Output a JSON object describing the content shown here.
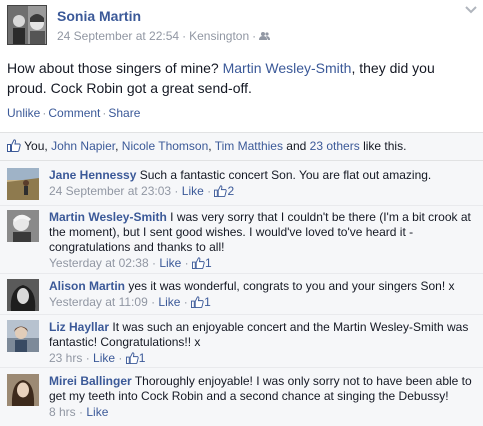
{
  "post": {
    "author": "Sonia Martin",
    "date": "24 September at 22:54",
    "location": "Kensington",
    "text_before": "How about those singers of mine? ",
    "mention": "Martin Wesley-Smith",
    "text_after": ", they did you proud. Cock Robin got a great send-off.",
    "actions": {
      "unlike": "Unlike",
      "comment": "Comment",
      "share": "Share"
    }
  },
  "likes": {
    "you": "You,",
    "names": [
      "John Napier",
      "Nicole Thomson",
      "Tim Matthies"
    ],
    "and": "and",
    "others": "23 others",
    "suffix": "like this."
  },
  "comments": [
    {
      "author": "Jane Hennessy",
      "text": "Such a fantastic concert Son. You are flat out amazing.",
      "time": "24 September at 23:03",
      "like": "Like",
      "count": "2"
    },
    {
      "author": "Martin Wesley-Smith",
      "text": "I was very sorry that I couldn't be there (I'm a bit crook at the moment), but I sent good wishes. I would've loved to've heard it - congratulations and thanks to all!",
      "time": "Yesterday at 02:38",
      "like": "Like",
      "count": "1"
    },
    {
      "author": "Alison Martin",
      "text": "yes it was wonderful, congrats to you and your singers Son! x",
      "time": "Yesterday at 11:09",
      "like": "Like",
      "count": "1"
    },
    {
      "author": "Liz Hayllar",
      "text": "It was such an enjoyable concert and the Martin Wesley-Smith was fantastic! Congratulations!! x",
      "time": "23 hrs",
      "like": "Like",
      "count": "1"
    },
    {
      "author": "Mirei Ballinger",
      "text": "Thoroughly enjoyable! I was only sorry not to have been able to get my teeth into Cock Robin and a second chance at singing the Debussy!",
      "time": "8 hrs",
      "like": "Like",
      "count": ""
    }
  ],
  "colors": {
    "link": "#3b5998",
    "meta": "#9197a3",
    "ufi_bg": "#f6f7f9"
  },
  "icons": {
    "audience": "friends-icon",
    "menu": "chevron-down-icon",
    "like": "thumbs-up-icon"
  }
}
